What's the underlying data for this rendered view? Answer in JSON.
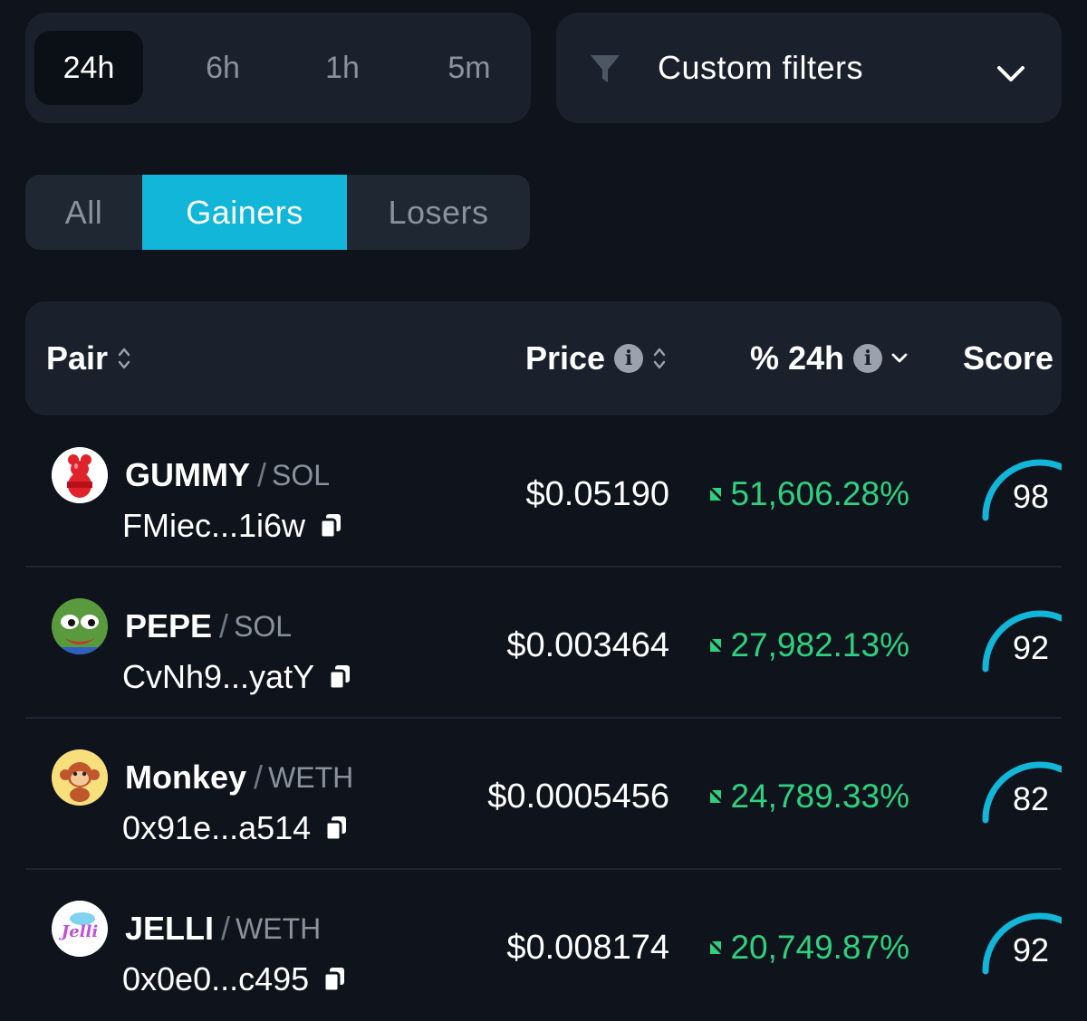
{
  "timeframes": [
    {
      "label": "24h",
      "active": true
    },
    {
      "label": "6h",
      "active": false
    },
    {
      "label": "1h",
      "active": false
    },
    {
      "label": "5m",
      "active": false
    }
  ],
  "filters": {
    "label": "Custom filters",
    "icon": "funnel-icon"
  },
  "segments": [
    {
      "label": "All",
      "active": false
    },
    {
      "label": "Gainers",
      "active": true
    },
    {
      "label": "Losers",
      "active": false
    }
  ],
  "table": {
    "columns": {
      "pair": "Pair",
      "price": "Price",
      "change": "% 24h",
      "score": "Score"
    },
    "rows": [
      {
        "symbol": "GUMMY",
        "quote": "SOL",
        "address": "FMiec...1i6w",
        "price": "$0.05190",
        "change": "51,606.28%",
        "score": "98",
        "score_value": 98
      },
      {
        "symbol": "PEPE",
        "quote": "SOL",
        "address": "CvNh9...yatY",
        "price": "$0.003464",
        "change": "27,982.13%",
        "score": "92",
        "score_value": 92
      },
      {
        "symbol": "Monkey",
        "quote": "WETH",
        "address": "0x91e...a514",
        "price": "$0.0005456",
        "change": "24,789.33%",
        "score": "82",
        "score_value": 82
      },
      {
        "symbol": "JELLI",
        "quote": "WETH",
        "address": "0x0e0...c495",
        "price": "$0.008174",
        "change": "20,749.87%",
        "score": "92",
        "score_value": 92
      }
    ]
  },
  "colors": {
    "background": "#0e131c",
    "panel": "#1a212c",
    "accent": "#11b6d8",
    "gain": "#2fd07f"
  }
}
